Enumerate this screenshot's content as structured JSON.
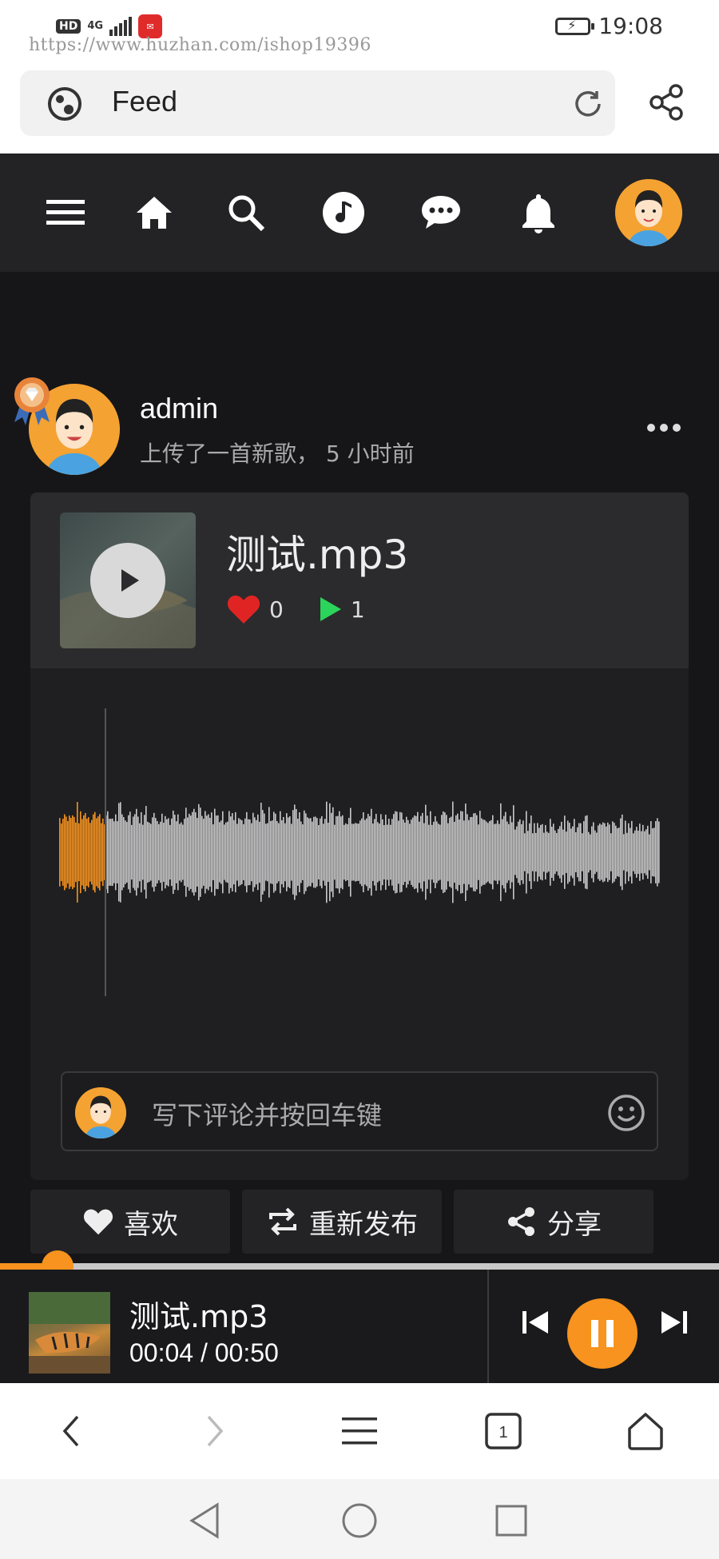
{
  "status_bar": {
    "left_hd": "HD",
    "left_network": "4G",
    "time": "19:08"
  },
  "watermark": "https://www.huzhan.com/ishop19396",
  "browser": {
    "url_text": "Feed"
  },
  "nav": {
    "items": [
      "menu-icon",
      "home-icon",
      "search-icon",
      "music-icon",
      "chat-icon",
      "bell-icon",
      "avatar"
    ]
  },
  "post": {
    "username": "admin",
    "subline": "上传了一首新歌， 5 小时前",
    "track": {
      "title": "测试.mp3",
      "likes": "0",
      "plays": "1"
    },
    "comment_placeholder": "写下评论并按回车键"
  },
  "actions": {
    "like": "喜欢",
    "repost": "重新发布",
    "share": "分享"
  },
  "player": {
    "title": "测试.mp3",
    "time": "00:04 / 00:50",
    "progress_fraction": 0.08
  },
  "colors": {
    "accent": "#f7931e",
    "like": "#e02424",
    "play_count": "#2bd45a"
  }
}
